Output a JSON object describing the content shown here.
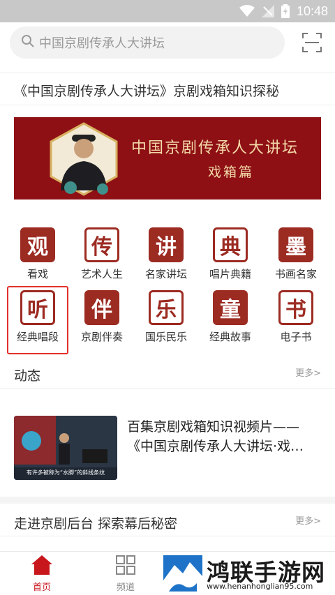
{
  "status": {
    "time": "10:48"
  },
  "search": {
    "placeholder": "中国京剧传承人大讲坛"
  },
  "headline": "《中国京剧传承人大讲坛》京剧戏箱知识探秘",
  "banner": {
    "title1": "中国京剧传承人大讲坛",
    "title2": "戏箱篇"
  },
  "categories": [
    {
      "label": "看戏",
      "glyph": "观",
      "style": "solid"
    },
    {
      "label": "艺术人生",
      "glyph": "传",
      "style": "outline"
    },
    {
      "label": "名家讲坛",
      "glyph": "讲",
      "style": "solid"
    },
    {
      "label": "唱片典籍",
      "glyph": "典",
      "style": "outline"
    },
    {
      "label": "书画名家",
      "glyph": "墨",
      "style": "solid"
    },
    {
      "label": "经典唱段",
      "glyph": "听",
      "style": "outline"
    },
    {
      "label": "京剧伴奏",
      "glyph": "伴",
      "style": "solid"
    },
    {
      "label": "国乐民乐",
      "glyph": "乐",
      "style": "outline"
    },
    {
      "label": "经典故事",
      "glyph": "童",
      "style": "solid"
    },
    {
      "label": "电子书",
      "glyph": "书",
      "style": "outline"
    }
  ],
  "dynamics": {
    "title": "动态",
    "more": "更多>",
    "item": {
      "title": "百集京剧戏箱知识视频片——《中国京剧传承人大讲坛·戏…",
      "thumb_caption": "有许多被称为“水脚”的斜线条纹"
    }
  },
  "backstage": {
    "title": "走进京剧后台 探索幕后秘密",
    "more": "更多>"
  },
  "tabs": [
    {
      "label": "首页",
      "icon": "home-icon",
      "active": true
    },
    {
      "label": "频道",
      "icon": "grid-icon",
      "active": false
    }
  ],
  "watermark": {
    "cn": "鸿联手游网",
    "url": "www.henanhonglian95.com"
  },
  "colors": {
    "accent": "#c8161d",
    "seal": "#9c2b22",
    "banner": "#8e1015"
  }
}
